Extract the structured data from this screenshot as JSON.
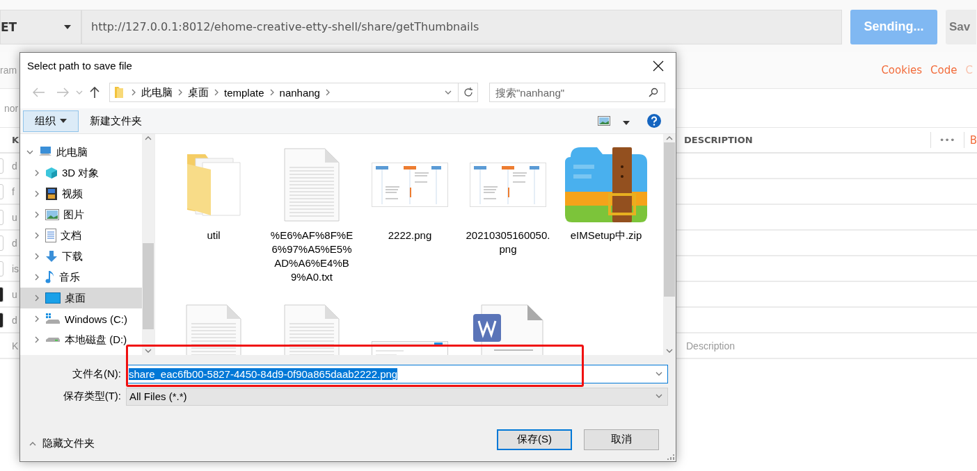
{
  "app": {
    "method": "ET",
    "url": "http://127.0.0.1:8012/ehome-creative-etty-shell/share/getThumbnails",
    "send_button": "Sending...",
    "save_button": "Sav",
    "tab_fragment": "ram",
    "links": [
      {
        "label": "Cookies",
        "disabled": false
      },
      {
        "label": "Code",
        "disabled": false
      },
      {
        "label": "C",
        "disabled": true
      }
    ],
    "body_fragment": "nor",
    "table": {
      "key_header": "K",
      "description_header": "DESCRIPTION",
      "more": "•••",
      "bulk": "B",
      "rows": [
        {
          "key": "d",
          "checked": false
        },
        {
          "key": "f",
          "checked": false
        },
        {
          "key": "u",
          "checked": false
        },
        {
          "key": "d",
          "checked": false
        },
        {
          "key": "is",
          "checked": false
        },
        {
          "key": "u",
          "checked": true
        },
        {
          "key": "d",
          "checked": true
        }
      ],
      "new_row": {
        "key_placeholder": "K",
        "description_placeholder": "Description"
      }
    }
  },
  "dialog": {
    "title": "Select path to save file",
    "breadcrumbs": [
      "此电脑",
      "桌面",
      "template",
      "nanhang"
    ],
    "search": {
      "placeholder": "搜索\"nanhang\""
    },
    "toolbar": {
      "organize": "组织",
      "new_folder": "新建文件夹"
    },
    "tree": [
      {
        "label": "此电脑",
        "expanded": true,
        "selected": false,
        "children": [
          {
            "label": "3D 对象",
            "expanded": false,
            "selected": false
          },
          {
            "label": "视频",
            "expanded": false,
            "selected": false
          },
          {
            "label": "图片",
            "expanded": false,
            "selected": false
          },
          {
            "label": "文档",
            "expanded": false,
            "selected": false
          },
          {
            "label": "下载",
            "expanded": false,
            "selected": false
          },
          {
            "label": "音乐",
            "expanded": false,
            "selected": false
          },
          {
            "label": "桌面",
            "expanded": false,
            "selected": true
          },
          {
            "label": "Windows (C:)",
            "expanded": false,
            "selected": false
          },
          {
            "label": "本地磁盘 (D:)",
            "expanded": false,
            "selected": false
          }
        ]
      }
    ],
    "files": [
      {
        "label": "util",
        "kind": "folder"
      },
      {
        "label": "%E6%AF%8F%E6%97%A5%E5%AD%A6%E4%B9%A0.txt",
        "kind": "text"
      },
      {
        "label": "2222.png",
        "kind": "image"
      },
      {
        "label": "20210305160050.png",
        "kind": "image"
      },
      {
        "label": "eIMSetup中.zip",
        "kind": "archive"
      },
      {
        "kind": "text"
      },
      {
        "kind": "text"
      },
      {
        "kind": "screenshot"
      },
      {
        "kind": "document"
      }
    ],
    "filename": {
      "label": "文件名(N):",
      "value": "share_eac6fb00-5827-4450-84d9-0f90a865daab2222.png"
    },
    "filetype": {
      "label": "保存类型(T):",
      "value": "All Files (*.*)"
    },
    "hide_folders": "隐藏文件夹",
    "save": "保存(S)",
    "cancel": "取消"
  }
}
